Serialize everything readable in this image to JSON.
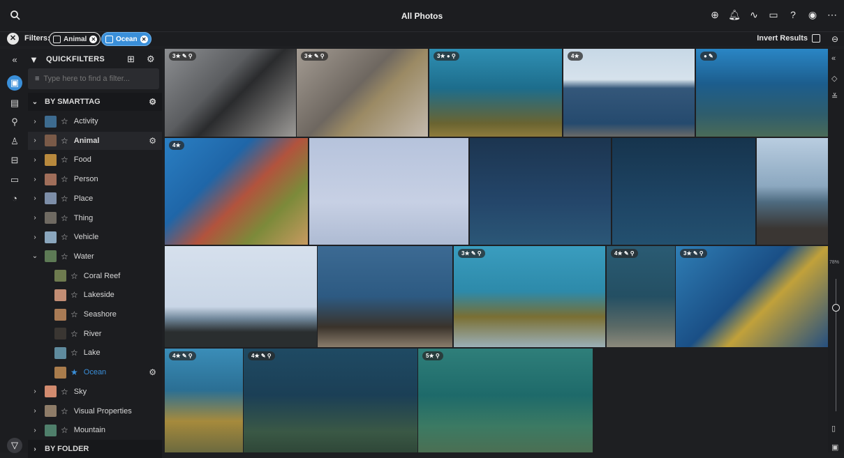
{
  "header": {
    "title": "All Photos"
  },
  "filters": {
    "label": "Filters:",
    "chips": [
      {
        "label": "Animal"
      },
      {
        "label": "Ocean"
      }
    ],
    "invert_label": "Invert Results"
  },
  "quickfilters": {
    "title": "QUICKFILTERS",
    "search_placeholder": "Type here to find a filter...",
    "section_smarttag": "BY SMARTTAG",
    "section_folder": "BY FOLDER",
    "items": [
      {
        "label": "Activity",
        "color": "#3d6b8f"
      },
      {
        "label": "Animal",
        "color": "#7a5a48"
      },
      {
        "label": "Food",
        "color": "#b8893d"
      },
      {
        "label": "Person",
        "color": "#a06e5a"
      },
      {
        "label": "Place",
        "color": "#7d8ea8"
      },
      {
        "label": "Thing",
        "color": "#6f6a62"
      },
      {
        "label": "Vehicle",
        "color": "#8aa6bd"
      },
      {
        "label": "Water",
        "color": "#5d7a55"
      },
      {
        "label": "Coral Reef",
        "color": "#6e7b4f"
      },
      {
        "label": "Lakeside",
        "color": "#c28d74"
      },
      {
        "label": "Seashore",
        "color": "#a97b55"
      },
      {
        "label": "River",
        "color": "#3a3632"
      },
      {
        "label": "Lake",
        "color": "#5f8b9e"
      },
      {
        "label": "Ocean",
        "color": "#a97c4c"
      },
      {
        "label": "Sky",
        "color": "#d28b6f"
      },
      {
        "label": "Visual Properties",
        "color": "#8e7c68"
      },
      {
        "label": "Mountain",
        "color": "#4f7f6b"
      }
    ]
  },
  "zoom": {
    "label": "78%"
  },
  "photos": [
    {
      "badge": "3★ ✎ ⚲",
      "bg": "linear-gradient(135deg,#8d8f92,#5b5d60 40%,#2a2b2d 55%,#9c9a97)"
    },
    {
      "badge": "3★ ✎ ⚲",
      "bg": "linear-gradient(135deg,#a49c93,#6e6760 45%,#9b8a64 60%,#c3b9ad)"
    },
    {
      "badge": "3★ ● ⚲",
      "bg": "linear-gradient(180deg,#2f8fb3,#1d6d8c 45%,#6a6431 85%,#8e7b3c)"
    },
    {
      "badge": "4★",
      "bg": "linear-gradient(180deg,#c7d8e6,#d6e2ec 35%,#34577a 45%,#254a6e 85%,#6a6a68)"
    },
    {
      "badge": "● ✎",
      "bg": "linear-gradient(180deg,#2a86c5,#1c5d8d 40%,#2f5d6c 75%,#4a6b58)"
    },
    {
      "badge": "4★",
      "bg": "linear-gradient(135deg,#2a7fc3,#1f66a8 35%,#b2533d 55%,#7c8a3a 75%,#c79a60)"
    },
    {
      "badge": "",
      "bg": "linear-gradient(180deg,#b6c3dc,#c7d0e4 60%,#aebbd3)"
    },
    {
      "badge": "",
      "bg": "linear-gradient(180deg,#1c3550,#24466a 60%,#2b5777)"
    },
    {
      "badge": "",
      "bg": "linear-gradient(180deg,#16344d,#1e4565 60%,#23506f)"
    },
    {
      "badge": "",
      "bg": "linear-gradient(180deg,#b9cde0,#8ca8c0 45%,#4e6b80 60%,#3a3633 85%)"
    },
    {
      "badge": "",
      "bg": "linear-gradient(180deg,#d6e0ed,#c9d6e6 60%,#6f8699 72%,#2a2e2f 85%)"
    },
    {
      "badge": "",
      "bg": "linear-gradient(180deg,#3c6a93,#2d5a82 50%,#3a332b 80%,#8a7d6c)"
    },
    {
      "badge": "3★ ✎ ⚲",
      "bg": "linear-gradient(180deg,#3a9dbf,#2d8aaa 45%,#7a6f33 70%,#9bb0b8)"
    },
    {
      "badge": "4★ ✎ ⚲",
      "bg": "linear-gradient(180deg,#2a5b73,#244f63 50%,#5b6a66 80%,#8c8a7c)"
    },
    {
      "badge": "3★ ✎ ⚲",
      "bg": "linear-gradient(135deg,#2f7eb5,#1a4f86 45%,#c1a13a 60%,#254f7f)"
    },
    {
      "badge": "4★ ✎ ⚲",
      "bg": "linear-gradient(180deg,#3a8db8,#2b6f94 40%,#a68a3c 70%,#6c6a3f)"
    },
    {
      "badge": "4★ ✎ ⚲",
      "bg": "linear-gradient(180deg,#1f4a63,#1b3f56 45%,#3a5845 80%,#2f4738)"
    },
    {
      "badge": "5★ ⚲",
      "bg": "linear-gradient(180deg,#2f7f7a,#1e6a6a 45%,#3c7a63 75%,#4b6f53)"
    }
  ]
}
